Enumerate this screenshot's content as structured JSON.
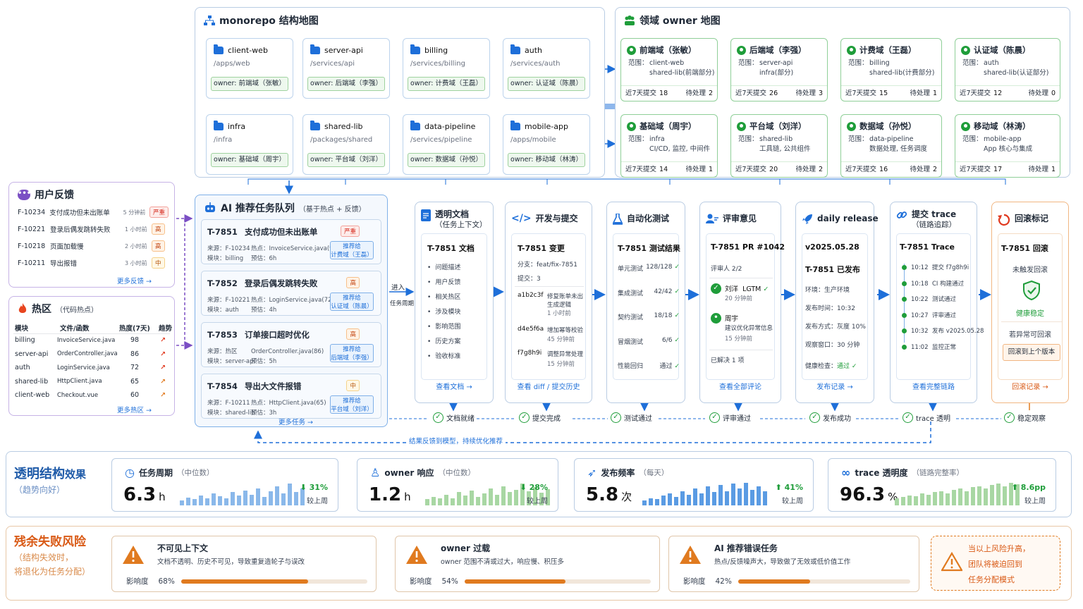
{
  "monorepo": {
    "title": "monorepo 结构地图",
    "repos": [
      {
        "name": "client-web",
        "path": "/apps/web",
        "owner": "owner: 前端域（张敏）"
      },
      {
        "name": "server-api",
        "path": "/services/api",
        "owner": "owner: 后端域（李强）"
      },
      {
        "name": "billing",
        "path": "/services/billing",
        "owner": "owner: 计费域（王磊）"
      },
      {
        "name": "auth",
        "path": "/services/auth",
        "owner": "owner: 认证域（陈晨）"
      },
      {
        "name": "infra",
        "path": "/infra",
        "owner": "owner: 基础域（周宇）"
      },
      {
        "name": "shared-lib",
        "path": "/packages/shared",
        "owner": "owner: 平台域（刘洋）"
      },
      {
        "name": "data-pipeline",
        "path": "/services/pipeline",
        "owner": "owner: 数据域（孙悦）"
      },
      {
        "name": "mobile-app",
        "path": "/apps/mobile",
        "owner": "owner: 移动域（林涛）"
      }
    ]
  },
  "owners": {
    "title": "领域 owner 地图",
    "scope_label": "范围：",
    "commits_label": "近7天提交",
    "pending_label": "待处理",
    "items": [
      {
        "name": "前端域（张敏）",
        "scope1": "client-web",
        "scope2": "shared-lib(前端部分)",
        "commits": "18",
        "pending": "2"
      },
      {
        "name": "后端域（李强）",
        "scope1": "server-api",
        "scope2": "infra(部分)",
        "commits": "26",
        "pending": "3"
      },
      {
        "name": "计费域（王磊）",
        "scope1": "billing",
        "scope2": "shared-lib(计费部分)",
        "commits": "15",
        "pending": "1"
      },
      {
        "name": "认证域（陈晨）",
        "scope1": "auth",
        "scope2": "shared-lib(认证部分)",
        "commits": "12",
        "pending": "0"
      },
      {
        "name": "基础域（周宇）",
        "scope1": "infra",
        "scope2": "CI/CD, 监控, 中间件",
        "commits": "14",
        "pending": "1"
      },
      {
        "name": "平台域（刘洋）",
        "scope1": "shared-lib",
        "scope2": "工具链, 公共组件",
        "commits": "20",
        "pending": "2"
      },
      {
        "name": "数据域（孙悦）",
        "scope1": "data-pipeline",
        "scope2": "数据处理, 任务调度",
        "commits": "16",
        "pending": "2"
      },
      {
        "name": "移动域（林涛）",
        "scope1": "mobile-app",
        "scope2": "App 核心与集成",
        "commits": "17",
        "pending": "1"
      }
    ]
  },
  "feedback": {
    "title": "用户反馈",
    "more": "更多反馈 →",
    "items": [
      {
        "id": "F-10234",
        "text": "支付成功但未出账单",
        "time": "5 分钟前",
        "level": "严重",
        "tone": "red"
      },
      {
        "id": "F-10221",
        "text": "登录后偶发跳转失败",
        "time": "1 小时前",
        "level": "高",
        "tone": "org"
      },
      {
        "id": "F-10218",
        "text": "页面加载慢",
        "time": "2 小时前",
        "level": "高",
        "tone": "org"
      },
      {
        "id": "F-10211",
        "text": "导出报错",
        "time": "3 小时前",
        "level": "中",
        "tone": "yel"
      }
    ]
  },
  "hotspots": {
    "title": "热区",
    "subtitle": "（代码热点）",
    "headers": [
      "模块",
      "文件/函数",
      "热度(7天)",
      "趋势"
    ],
    "more": "更多热区 →",
    "rows": [
      {
        "module": "billing",
        "file": "InvoiceService.java",
        "heat": "98"
      },
      {
        "module": "server-api",
        "file": "OrderController.java",
        "heat": "86"
      },
      {
        "module": "auth",
        "file": "LoginService.java",
        "heat": "72"
      },
      {
        "module": "shared-lib",
        "file": "HttpClient.java",
        "heat": "65"
      },
      {
        "module": "client-web",
        "file": "Checkout.vue",
        "heat": "60"
      }
    ]
  },
  "queue": {
    "title": "AI 推荐任务队列",
    "subtitle": "（基于热点 + 反馈）",
    "more": "更多任务 →",
    "entry_label": "进入",
    "entry_label2": "任务周期",
    "tasks": [
      {
        "id": "T-7851",
        "title": "支付成功但未出账单",
        "tag": "严重",
        "tone": "red",
        "src": "来源：F-10234",
        "hot": "热点：InvoiceService.java(98)",
        "module": "模块：billing",
        "est": "预估：6h",
        "rec1": "推荐给",
        "rec2": "计费域（王磊）"
      },
      {
        "id": "T-7852",
        "title": "登录后偶发跳转失败",
        "tag": "高",
        "tone": "org",
        "src": "来源：F-10221",
        "hot": "热点：LoginService.java(72)",
        "module": "模块：auth",
        "est": "预估：4h",
        "rec1": "推荐给",
        "rec2": "认证域（陈晨）"
      },
      {
        "id": "T-7853",
        "title": "订单接口超时优化",
        "tag": "高",
        "tone": "org",
        "src": "来源：热区",
        "hot": "OrderController.java(86)",
        "module": "模块：server-api",
        "est": "预估：5h",
        "rec1": "推荐给",
        "rec2": "后端域（李强）"
      },
      {
        "id": "T-7854",
        "title": "导出大文件报错",
        "tag": "中",
        "tone": "yel",
        "src": "来源：F-10211",
        "hot": "热点：HttpClient.java(65)",
        "module": "模块：shared-lib",
        "est": "预估：3h",
        "rec1": "推荐给",
        "rec2": "平台域（刘洋）"
      }
    ]
  },
  "stages": {
    "doc": {
      "title": "透明文档",
      "subtitle": "（任务上下文）",
      "heading": "T-7851 文档",
      "items": [
        "问题描述",
        "用户反馈",
        "相关热区",
        "涉及模块",
        "影响范围",
        "历史方案",
        "验收标准"
      ],
      "link": "查看文档 →",
      "status": "文档就绪"
    },
    "dev": {
      "title": "开发与提交",
      "heading": "T-7851 变更",
      "branch": "分支：feat/fix-7851",
      "commits": "提交：3",
      "c1_hash": "a1b2c3f",
      "c1_msg": "修复账单未出",
      "c1_msg2": "生成逻辑",
      "c1_time": "1 小时前",
      "c2_hash": "d4e5f6a",
      "c2_msg": "增加幂等校验",
      "c2_time": "45 分钟前",
      "c3_hash": "f7g8h9i",
      "c3_msg": "调整异常处理",
      "c3_time": "15 分钟前",
      "link": "查看 diff / 提交历史",
      "status": "提交完成"
    },
    "test": {
      "title": "自动化测试",
      "heading": "T-7851 测试结果",
      "rows": [
        {
          "name": "单元测试",
          "val": "128/128"
        },
        {
          "name": "集成测试",
          "val": "42/42"
        },
        {
          "name": "契约测试",
          "val": "18/18"
        },
        {
          "name": "冒烟测试",
          "val": "6/6"
        },
        {
          "name": "性能回归",
          "val": "通过"
        }
      ],
      "status": "测试通过"
    },
    "review": {
      "title": "评审意见",
      "heading": "T-7851 PR #1042",
      "reviewers": "评审人 2/2",
      "r1_name": "刘洋",
      "r1_note": "LGTM",
      "r1_time": "20 分钟前",
      "r2_name": "周宇",
      "r2_note": "建议优化异常信息",
      "r2_time": "15 分钟前",
      "resolved": "已解决 1 项",
      "link": "查看全部评论",
      "status": "评审通过"
    },
    "release": {
      "title": "daily release",
      "version": "v2025.05.28",
      "heading": "T-7851 已发布",
      "env": "环境：生产环境",
      "time": "发布时间：10:32",
      "mode": "发布方式：灰度 10%",
      "window": "观察窗口：30 分钟",
      "health": "健康检查：",
      "health_val": "通过",
      "link": "发布记录 →",
      "status": "发布成功"
    },
    "trace": {
      "title": "提交 trace",
      "subtitle": "（链路追踪）",
      "heading": "T-7851 Trace",
      "events": [
        {
          "t": "10:12",
          "e": "提交 f7g8h9i"
        },
        {
          "t": "10:18",
          "e": "CI 构建通过"
        },
        {
          "t": "10:22",
          "e": "测试通过"
        },
        {
          "t": "10:27",
          "e": "评审通过"
        },
        {
          "t": "10:32",
          "e": "发布 v2025.05.28"
        },
        {
          "t": "11:02",
          "e": "监控正常"
        }
      ],
      "link": "查看完整链路",
      "status": "trace 透明"
    },
    "rollback": {
      "title": "回滚标记",
      "heading": "T-7851 回滚",
      "line1": "未触发回滚",
      "health": "健康稳定",
      "line2": "若异常可回滚",
      "button": "回滚到上个版本",
      "link": "回滚记录 →",
      "status": "稳定观察"
    }
  },
  "feedback_loop": "结果反馈到模型，持续优化推荐",
  "effect": {
    "title1": "透明结构",
    "title2": "效果",
    "subtitle": "（趋势向好）",
    "metrics": [
      {
        "label": "任务周期",
        "sub": "（中位数）",
        "value": "6.3",
        "unit": "h",
        "delta": "31%",
        "dir": "down",
        "cmp": "较上周",
        "color": "#8ab8ea",
        "bars": [
          0.22,
          0.32,
          0.26,
          0.42,
          0.3,
          0.5,
          0.38,
          0.28,
          0.55,
          0.4,
          0.62,
          0.45,
          0.7,
          0.35,
          0.6,
          0.8,
          0.5,
          0.9,
          0.55,
          0.72
        ]
      },
      {
        "label": "owner 响应",
        "sub": "（中位数）",
        "value": "1.2",
        "unit": "h",
        "delta": "28%",
        "dir": "down",
        "cmp": "较上周",
        "color": "#a8d7a3",
        "bars": [
          0.25,
          0.35,
          0.3,
          0.45,
          0.28,
          0.55,
          0.4,
          0.62,
          0.35,
          0.5,
          0.7,
          0.45,
          0.8,
          0.55,
          0.65,
          0.9,
          0.6,
          0.75,
          0.52,
          0.68
        ]
      },
      {
        "label": "发布频率",
        "sub": "（每天）",
        "value": "5.8",
        "unit": "次",
        "delta": "41%",
        "dir": "up",
        "cmp": "较上周",
        "color": "#5a9be3",
        "bars": [
          0.2,
          0.3,
          0.25,
          0.4,
          0.5,
          0.35,
          0.6,
          0.45,
          0.7,
          0.5,
          0.78,
          0.55,
          0.85,
          0.6,
          0.9,
          0.7,
          0.95,
          0.65,
          0.8,
          0.6
        ]
      },
      {
        "label": "trace 透明度",
        "sub": "（链路完整率）",
        "value": "96.3",
        "unit": "%",
        "delta": "8.6pp",
        "dir": "up",
        "cmp": "较上周",
        "color": "#a8d7a3",
        "bars": [
          0.3,
          0.35,
          0.4,
          0.38,
          0.5,
          0.45,
          0.55,
          0.6,
          0.5,
          0.65,
          0.7,
          0.6,
          0.75,
          0.8,
          0.7,
          0.85,
          0.9,
          0.8,
          0.95,
          0.88
        ]
      }
    ]
  },
  "risk": {
    "title": "残余失败风险",
    "sub1": "（结构失效时，",
    "sub2": "将退化为任务分配）",
    "impact_label": "影响度",
    "items": [
      {
        "title": "不可见上下文",
        "desc": "文档不透明、历史不可见，导致重复造轮子与误改",
        "pct": "68%",
        "val": 0.68
      },
      {
        "title": "owner 过载",
        "desc": "owner 范围不清或过大，响应慢、积压多",
        "pct": "54%",
        "val": 0.54
      },
      {
        "title": "AI 推荐错误任务",
        "desc": "热点/反馈噪声大，导致做了无效或低价值工作",
        "pct": "42%",
        "val": 0.42
      }
    ],
    "note1": "当以上风险升高，",
    "note2": "团队将被迫回到",
    "note3": "任务分配模式"
  }
}
